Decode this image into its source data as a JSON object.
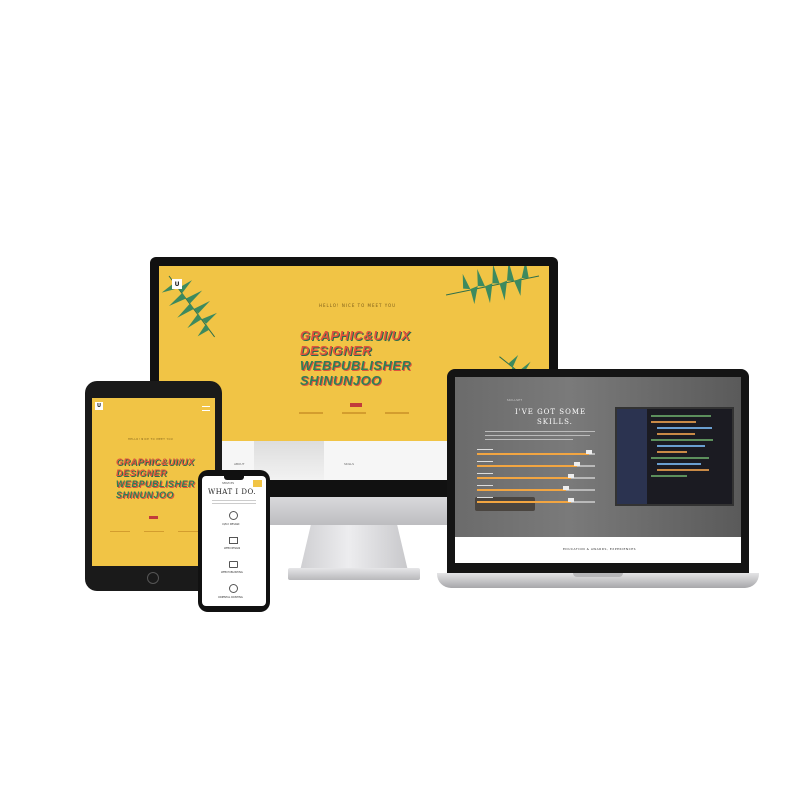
{
  "hero": {
    "intro": "HELLO! NICE TO MEET YOU",
    "line1": "GRAPHIC&UI/UX",
    "line2": "DESIGNER",
    "line3": "WEBPUBLISHER",
    "line4": "SHINUNJOO",
    "button": "ABOUT",
    "nav": [
      "ABOUT",
      "SKILLS"
    ],
    "logo": "U"
  },
  "phone": {
    "label": "SERVICES",
    "title": "WHAT I DO.",
    "items": [
      "UI/UX DESIGN",
      "WEB DESIGN",
      "WEB PUBLISHING",
      "ORIENTAL PAINTING"
    ]
  },
  "laptop": {
    "label": "SKILLSET",
    "title_line1": "I'VE GOT SOME",
    "title_line2": "SKILLS.",
    "skills": [
      {
        "level": 0.95
      },
      {
        "level": 0.85
      },
      {
        "level": 0.8
      },
      {
        "level": 0.75
      },
      {
        "level": 0.8
      }
    ],
    "footer": "EDUCATION & AWARDS, EXPERIENCES"
  },
  "colors": {
    "hero_yellow": "#f1c445",
    "title_red": "#e0533c",
    "title_green": "#2f7d58",
    "skill_bar": "#f2a541"
  }
}
